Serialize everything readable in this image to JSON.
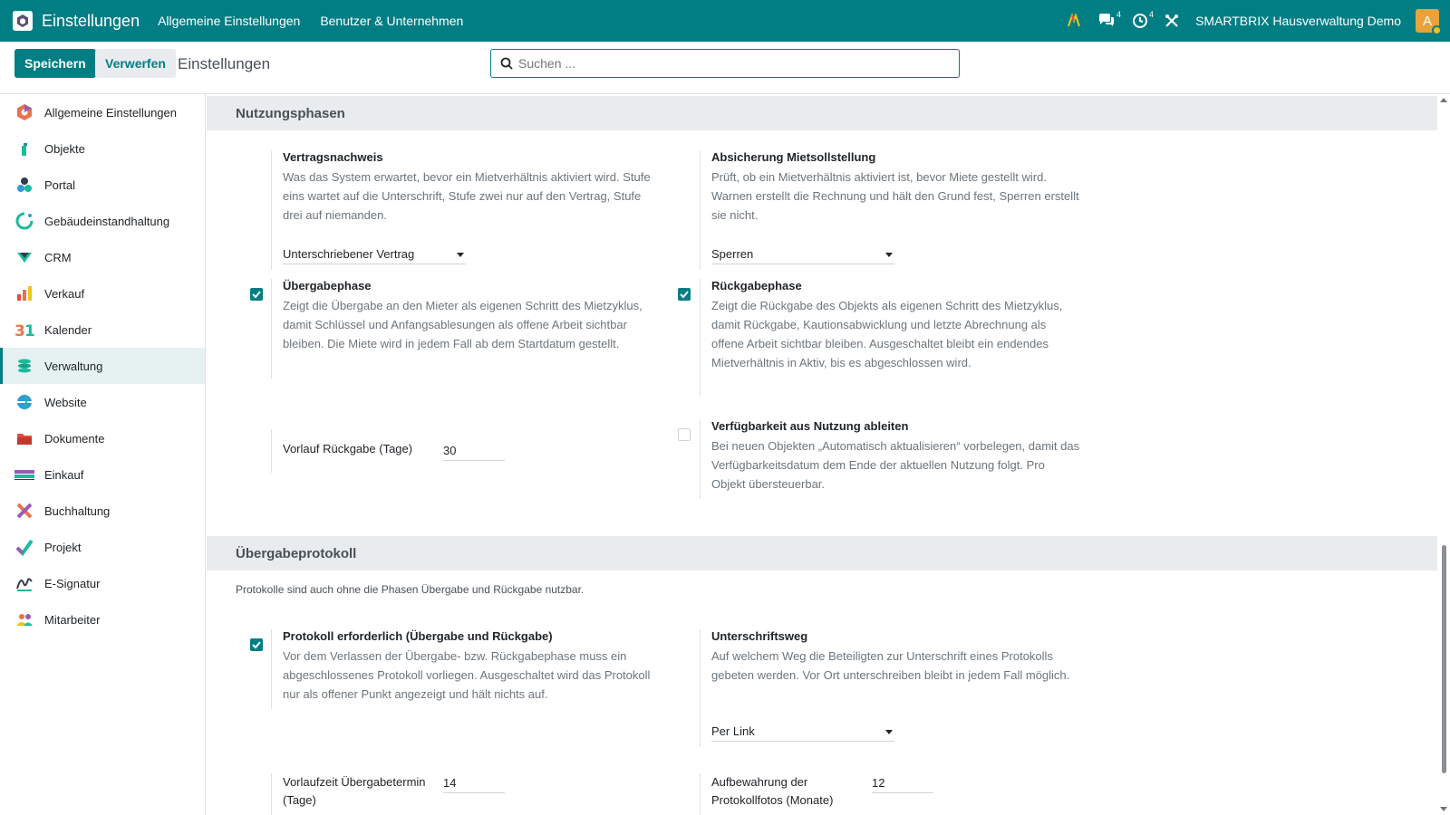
{
  "navbar": {
    "app_title": "Einstellungen",
    "menu": [
      "Allgemeine Einstellungen",
      "Benutzer & Unternehmen"
    ],
    "messages_count": "4",
    "activities_count": "4",
    "company": "SMARTBRIX Hausverwaltung Demo",
    "avatar_letter": "A",
    "color": "#017e84"
  },
  "control": {
    "save_label": "Speichern",
    "discard_label": "Verwerfen",
    "title": "Einstellungen",
    "search_placeholder": "Suchen ..."
  },
  "sidebar": {
    "items": [
      {
        "label": "Allgemeine Einstellungen",
        "icon": "settings-app-icon"
      },
      {
        "label": "Objekte",
        "icon": "objects-app-icon"
      },
      {
        "label": "Portal",
        "icon": "portal-app-icon"
      },
      {
        "label": "Gebäudeinstandhaltung",
        "icon": "maintenance-app-icon"
      },
      {
        "label": "CRM",
        "icon": "crm-app-icon"
      },
      {
        "label": "Verkauf",
        "icon": "sales-app-icon"
      },
      {
        "label": "Kalender",
        "icon": "calendar-app-icon"
      },
      {
        "label": "Verwaltung",
        "icon": "management-app-icon",
        "active": true
      },
      {
        "label": "Website",
        "icon": "website-app-icon"
      },
      {
        "label": "Dokumente",
        "icon": "documents-app-icon"
      },
      {
        "label": "Einkauf",
        "icon": "purchase-app-icon"
      },
      {
        "label": "Buchhaltung",
        "icon": "accounting-app-icon"
      },
      {
        "label": "Projekt",
        "icon": "project-app-icon"
      },
      {
        "label": "E-Signatur",
        "icon": "esign-app-icon"
      },
      {
        "label": "Mitarbeiter",
        "icon": "employees-app-icon"
      }
    ]
  },
  "nutzungsphasen": {
    "heading": "Nutzungsphasen",
    "vertragsnachweis": {
      "title": "Vertragsnachweis",
      "desc": "Was das System erwartet, bevor ein Mietverhältnis aktiviert wird. Stufe eins wartet auf die Unterschrift, Stufe zwei nur auf den Vertrag, Stufe drei auf niemanden.",
      "value": "Unterschriebener Vertrag"
    },
    "absicherung": {
      "title": "Absicherung Mietsollstellung",
      "desc": "Prüft, ob ein Mietverhältnis aktiviert ist, bevor Miete gestellt wird. Warnen erstellt die Rechnung und hält den Grund fest, Sperren erstellt sie nicht.",
      "value": "Sperren"
    },
    "uebergabephase": {
      "title": "Übergabephase",
      "desc": "Zeigt die Übergabe an den Mieter als eigenen Schritt des Mietzyklus, damit Schlüssel und Anfangsablesungen als offene Arbeit sichtbar bleiben. Die Miete wird in jedem Fall ab dem Startdatum gestellt.",
      "checked": true
    },
    "rueckgabephase": {
      "title": "Rückgabephase",
      "desc": "Zeigt die Rückgabe des Objekts als eigenen Schritt des Mietzyklus, damit Rückgabe, Kautionsabwicklung und letzte Abrechnung als offene Arbeit sichtbar bleiben. Ausgeschaltet bleibt ein endendes Mietverhältnis in Aktiv, bis es abgeschlossen wird.",
      "checked": true
    },
    "vorlauf": {
      "label": "Vorlauf Rückgabe (Tage)",
      "value": "30"
    },
    "verfuegbarkeit": {
      "title": "Verfügbarkeit aus Nutzung ableiten",
      "desc": "Bei neuen Objekten „Automatisch aktualisieren“ vorbelegen, damit das Verfügbarkeitsdatum dem Ende der aktuellen Nutzung folgt. Pro Objekt übersteuerbar.",
      "checked": false
    }
  },
  "protokoll": {
    "heading": "Übergabeprotokoll",
    "note": "Protokolle sind auch ohne die Phasen Übergabe und Rückgabe nutzbar.",
    "erforderlich": {
      "title": "Protokoll erforderlich (Übergabe und Rückgabe)",
      "desc": "Vor dem Verlassen der Übergabe- bzw. Rückgabephase muss ein abgeschlossenes Protokoll vorliegen. Ausgeschaltet wird das Protokoll nur als offener Punkt angezeigt und hält nichts auf.",
      "checked": true
    },
    "unterschriftsweg": {
      "title": "Unterschriftsweg",
      "desc": "Auf welchem Weg die Beteiligten zur Unterschrift eines Protokolls gebeten werden. Vor Ort unterschreiben bleibt in jedem Fall möglich.",
      "value": "Per Link"
    },
    "vorlaufzeit": {
      "label": "Vorlaufzeit Übergabetermin (Tage)",
      "value": "14"
    },
    "aufbewahrung": {
      "label": "Aufbewahrung der Protokollfotos (Monate)",
      "value": "12"
    }
  }
}
